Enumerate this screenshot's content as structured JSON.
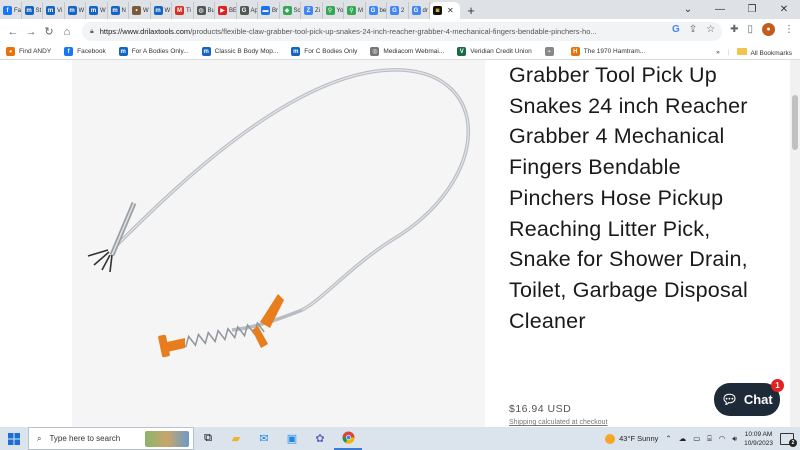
{
  "browser": {
    "tabs": [
      {
        "label": "Fa",
        "color": "#1877f2",
        "glyph": "f"
      },
      {
        "label": "St",
        "color": "#1565c0",
        "glyph": "m"
      },
      {
        "label": "Vi",
        "color": "#1565c0",
        "glyph": "m"
      },
      {
        "label": "W",
        "color": "#1565c0",
        "glyph": "m"
      },
      {
        "label": "W",
        "color": "#1565c0",
        "glyph": "m"
      },
      {
        "label": "N",
        "color": "#1565c0",
        "glyph": "m"
      },
      {
        "label": "W",
        "color": "#7a5a3a",
        "glyph": "•"
      },
      {
        "label": "W",
        "color": "#1565c0",
        "glyph": "m"
      },
      {
        "label": "Ti",
        "color": "#d93025",
        "glyph": "M"
      },
      {
        "label": "Bu",
        "color": "#555555",
        "glyph": "◍"
      },
      {
        "label": "BE",
        "color": "#e02020",
        "glyph": "▶"
      },
      {
        "label": "Ap",
        "color": "#555555",
        "glyph": "G"
      },
      {
        "label": "Br",
        "color": "#1a73e8",
        "glyph": "▬"
      },
      {
        "label": "Sc",
        "color": "#34a853",
        "glyph": "◆"
      },
      {
        "label": "Zi",
        "color": "#4285f4",
        "glyph": "Z"
      },
      {
        "label": "Yo",
        "color": "#34a853",
        "glyph": "⚲"
      },
      {
        "label": "M",
        "color": "#34a853",
        "glyph": "⚲"
      },
      {
        "label": "be",
        "color": "#4285f4",
        "glyph": "G"
      },
      {
        "label": "2",
        "color": "#4285f4",
        "glyph": "G"
      },
      {
        "label": "dr",
        "color": "#4285f4",
        "glyph": "G"
      }
    ],
    "active_tab_label": "",
    "active_tab_glyph": "◙",
    "new_tab_label": "+",
    "url_host": "https://www.drilaxtools.com",
    "url_path": "/products/flexible-claw-grabber-tool-pick-up-snakes-24-inch-reacher-grabber-4-mechanical-fingers-bendable-pinchers-ho..."
  },
  "bookmarks": [
    {
      "label": "Find ANDY",
      "color": "#e8710a",
      "glyph": "◕"
    },
    {
      "label": "Facebook",
      "color": "#1877f2",
      "glyph": "f"
    },
    {
      "label": "For A Bodies Only...",
      "color": "#1565c0",
      "glyph": "m"
    },
    {
      "label": "Classic B Body Mop...",
      "color": "#1565c0",
      "glyph": "m"
    },
    {
      "label": "For C Bodies Only",
      "color": "#1565c0",
      "glyph": "m"
    },
    {
      "label": "Mediacom Webmai...",
      "color": "#777777",
      "glyph": "◎"
    },
    {
      "label": "Veridian Credit Union",
      "color": "#1a6b4a",
      "glyph": "V"
    },
    {
      "label": "",
      "color": "#888888",
      "glyph": "⌁"
    },
    {
      "label": "The 1970 Hamtram...",
      "color": "#e8710a",
      "glyph": "H"
    }
  ],
  "bookmarks_all": "All Bookmarks",
  "bookmarks_overflow": "»",
  "product": {
    "title": "Grabber Tool Pick Up Snakes 24 inch Reacher Grabber 4 Mechanical Fingers Bendable Pinchers Hose Pickup Reaching Litter Pick, Snake for Shower Drain, Toilet, Garbage Disposal Cleaner",
    "price": "$16.94 USD",
    "shipping_note": "Shipping calculated at checkout"
  },
  "chat": {
    "label": "Chat",
    "badge": "1"
  },
  "taskbar": {
    "search_placeholder": "Type here to search",
    "weather": "43°F  Sunny",
    "time": "10:09 AM",
    "date": "10/9/2023",
    "notification_count": "2"
  },
  "colors": {
    "accent": "#e88a2c",
    "chat_bg": "#1f2a38"
  }
}
